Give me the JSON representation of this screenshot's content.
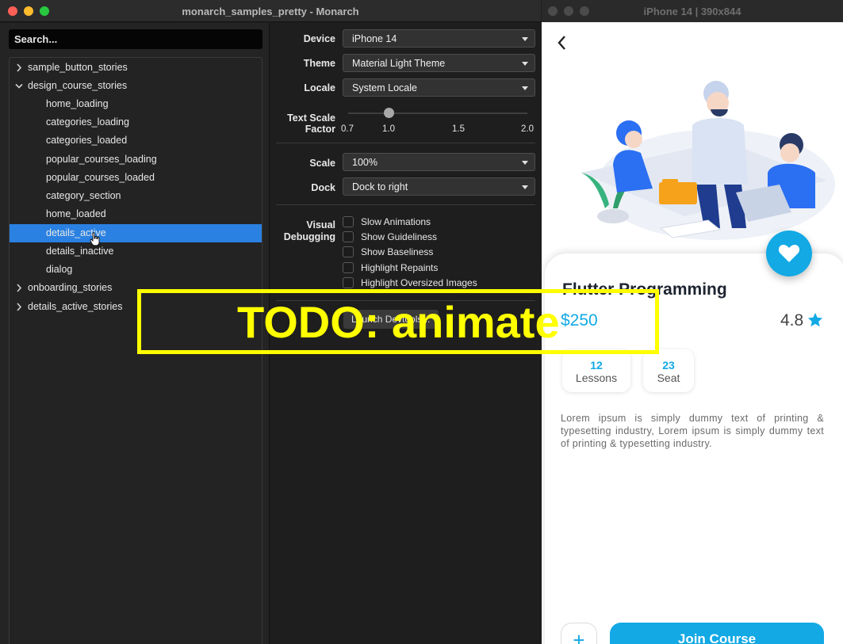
{
  "monarch": {
    "window_title": "monarch_samples_pretty - Monarch",
    "search_placeholder": "Search...",
    "tree": [
      {
        "label": "sample_button_stories",
        "kind": "group",
        "expanded": false
      },
      {
        "label": "design_course_stories",
        "kind": "group",
        "expanded": true
      },
      {
        "label": "home_loading",
        "kind": "story"
      },
      {
        "label": "categories_loading",
        "kind": "story"
      },
      {
        "label": "categories_loaded",
        "kind": "story"
      },
      {
        "label": "popular_courses_loading",
        "kind": "story"
      },
      {
        "label": "popular_courses_loaded",
        "kind": "story"
      },
      {
        "label": "category_section",
        "kind": "story"
      },
      {
        "label": "home_loaded",
        "kind": "story"
      },
      {
        "label": "details_active",
        "kind": "story",
        "selected": true
      },
      {
        "label": "details_inactive",
        "kind": "story"
      },
      {
        "label": "dialog",
        "kind": "story"
      },
      {
        "label": "onboarding_stories",
        "kind": "group",
        "expanded": false
      },
      {
        "label": "details_active_stories",
        "kind": "group",
        "expanded": false
      }
    ],
    "controls": {
      "device_label": "Device",
      "device_value": "iPhone 14",
      "theme_label": "Theme",
      "theme_value": "Material Light Theme",
      "locale_label": "Locale",
      "locale_value": "System Locale",
      "text_scale_label_1": "Text Scale",
      "text_scale_label_2": "Factor",
      "text_scale_ticks": [
        "0.7",
        "1.0",
        "1.5",
        "2.0"
      ],
      "text_scale_value": 1.0,
      "scale_label": "Scale",
      "scale_value": "100%",
      "dock_label": "Dock",
      "dock_value": "Dock to right",
      "visual_debugging_label_1": "Visual",
      "visual_debugging_label_2": "Debugging",
      "checkboxes": [
        "Slow Animations",
        "Show Guideliness",
        "Show Baseliness",
        "Highlight Repaints",
        "Highlight Oversized Images"
      ],
      "devtools_button": "Launch Devtools..."
    }
  },
  "phone": {
    "window_title": "iPhone 14 | 390x844",
    "course_title": "Flutter Programming",
    "price": "$250",
    "rating": "4.8",
    "stats": [
      {
        "value": "12",
        "label": "Lessons"
      },
      {
        "value": "23",
        "label": "Seat"
      }
    ],
    "description": "Lorem ipsum is simply dummy text of printing & typesetting industry, Lorem ipsum is simply dummy text of printing & typesetting industry.",
    "plus_label": "+",
    "join_label": "Join Course",
    "accent_color": "#12a9e5"
  },
  "overlay": {
    "text": "TODO: animate",
    "color": "#ffff00"
  }
}
